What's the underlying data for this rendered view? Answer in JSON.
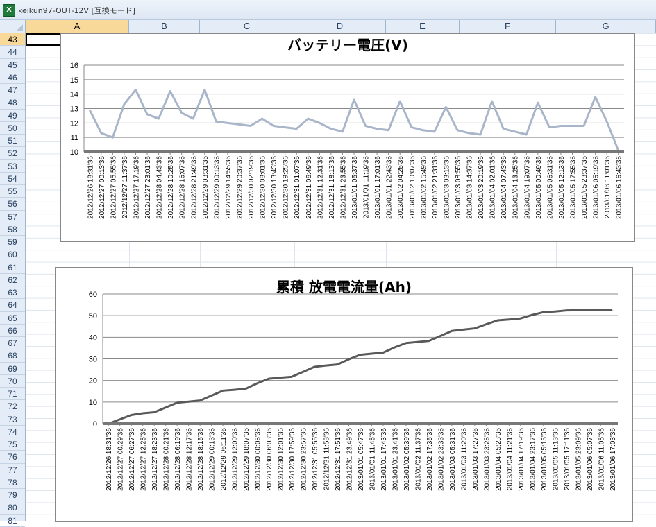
{
  "window": {
    "title": "keikun97-OUT-12V  [互換モード]",
    "app_icon": "excel-icon"
  },
  "sheet": {
    "columns": [
      "A",
      "B",
      "C",
      "D",
      "E",
      "F",
      "G"
    ],
    "selected_column": "A",
    "rows": [
      "43",
      "44",
      "45",
      "46",
      "47",
      "48",
      "49",
      "50",
      "51",
      "52",
      "53",
      "54",
      "55",
      "56",
      "57",
      "58",
      "59",
      "60",
      "61",
      "62",
      "63",
      "64",
      "65",
      "66",
      "67",
      "68",
      "69",
      "70",
      "71",
      "72",
      "73",
      "74",
      "75",
      "76",
      "77",
      "78",
      "79",
      "80",
      "81"
    ],
    "selected_row": "43"
  },
  "chart_data": [
    {
      "type": "line",
      "title": "バッテリー電圧(V)",
      "xlabel": "",
      "ylabel": "",
      "ylim": [
        10,
        16
      ],
      "yticks": [
        10,
        11,
        12,
        13,
        14,
        15,
        16
      ],
      "grid": true,
      "line_color": "#a9b5c9",
      "categories": [
        "2012/12/26 18:31'36",
        "2012/12/27 00:13'36",
        "2012/12/27 05:55'36",
        "2012/12/27 11:37'36",
        "2012/12/27 17:19'36",
        "2012/12/27 23:01'36",
        "2012/12/28 04:43'36",
        "2012/12/28 10:25'36",
        "2012/12/28 16:07'36",
        "2012/12/28 21:49'36",
        "2012/12/29 03:31'36",
        "2012/12/29 09:13'36",
        "2012/12/29 14:55'36",
        "2012/12/29 20:37'36",
        "2012/12/30 02:19'36",
        "2012/12/30 08:01'36",
        "2012/12/30 13:43'36",
        "2012/12/30 19:25'36",
        "2012/12/31 01:07'36",
        "2012/12/31 06:49'36",
        "2012/12/31 12:31'36",
        "2012/12/31 18:13'36",
        "2012/12/31 23:55'36",
        "2013/01/01 05:37'36",
        "2013/01/01 11:19'36",
        "2013/01/01 17:01'36",
        "2013/01/01 22:43'36",
        "2013/01/02 04:25'36",
        "2013/01/02 10:07'36",
        "2013/01/02 15:49'36",
        "2013/01/02 21:31'36",
        "2013/01/03 03:13'36",
        "2013/01/03 08:55'36",
        "2013/01/03 14:37'36",
        "2013/01/03 20:19'36",
        "2013/01/04 02:01'36",
        "2013/01/04 07:43'36",
        "2013/01/04 13:25'36",
        "2013/01/04 19:07'36",
        "2013/01/05 00:49'36",
        "2013/01/05 06:31'36",
        "2013/01/05 12:13'36",
        "2013/01/05 17:55'36",
        "2013/01/05 23:37'36",
        "2013/01/06 05:19'36",
        "2013/01/06 11:01'36",
        "2013/01/06 16:43'36"
      ],
      "series": [
        {
          "values": [
            12.9,
            11.3,
            11.0,
            13.3,
            14.3,
            12.6,
            12.3,
            14.2,
            12.7,
            12.3,
            14.3,
            12.1,
            12.0,
            11.9,
            11.8,
            12.3,
            11.8,
            11.7,
            11.6,
            12.3,
            12.0,
            11.6,
            11.4,
            13.6,
            11.8,
            11.6,
            11.5,
            13.5,
            11.7,
            11.5,
            11.4,
            13.1,
            11.5,
            11.3,
            11.2,
            13.5,
            11.6,
            11.4,
            11.2,
            13.4,
            11.7,
            11.8,
            11.8,
            11.8,
            13.8,
            12.1,
            10.1
          ]
        }
      ]
    },
    {
      "type": "line",
      "title": "累積  放電電流量(Ah)",
      "xlabel": "",
      "ylabel": "",
      "ylim": [
        0,
        60
      ],
      "yticks": [
        0,
        10,
        20,
        30,
        40,
        50,
        60
      ],
      "grid": true,
      "line_color": "#595959",
      "categories": [
        "2012/12/26 18:31'36",
        "2012/12/27 00:29'36",
        "2012/12/27 06:27'36",
        "2012/12/27 12:25'36",
        "2012/12/27 18:23'36",
        "2012/12/28 00:21'36",
        "2012/12/28 06:19'36",
        "2012/12/28 12:17'36",
        "2012/12/28 18:15'36",
        "2012/12/29 00:13'36",
        "2012/12/29 06:11'36",
        "2012/12/29 12:09'36",
        "2012/12/29 18:07'36",
        "2012/12/30 00:05'36",
        "2012/12/30 06:03'36",
        "2012/12/30 12:01'36",
        "2012/12/30 17:59'36",
        "2012/12/30 23:57'36",
        "2012/12/31 05:55'36",
        "2012/12/31 11:53'36",
        "2012/12/31 17:51'36",
        "2012/12/31 23:49'36",
        "2013/01/01 05:47'36",
        "2013/01/01 11:45'36",
        "2013/01/01 17:43'36",
        "2013/01/01 23:41'36",
        "2013/01/02 05:39'36",
        "2013/01/02 11:37'36",
        "2013/01/02 17:35'36",
        "2013/01/02 23:33'36",
        "2013/01/03 05:31'36",
        "2013/01/03 11:29'36",
        "2013/01/03 17:27'36",
        "2013/01/03 23:25'36",
        "2013/01/04 05:23'36",
        "2013/01/04 11:21'36",
        "2013/01/04 17:19'36",
        "2013/01/04 23:17'36",
        "2013/01/05 05:15'36",
        "2013/01/05 11:13'36",
        "2013/01/05 17:11'36",
        "2013/01/05 23:09'36",
        "2013/01/06 05:07'36",
        "2013/01/06 11:05'36",
        "2013/01/06 17:03'36"
      ],
      "series": [
        {
          "values": [
            0,
            2,
            4,
            4.8,
            5.3,
            7.5,
            9.7,
            10.2,
            10.7,
            13,
            15.3,
            15.7,
            16.2,
            18.7,
            20.8,
            21.3,
            21.7,
            24,
            26.3,
            26.9,
            27.4,
            29.8,
            31.9,
            32.4,
            32.9,
            35.3,
            37.3,
            37.8,
            38.3,
            40.6,
            42.9,
            43.5,
            44.1,
            46,
            47.8,
            48.2,
            48.7,
            50.3,
            51.6,
            51.9,
            52.4,
            52.5,
            52.5,
            52.5,
            52.5
          ]
        }
      ]
    }
  ]
}
